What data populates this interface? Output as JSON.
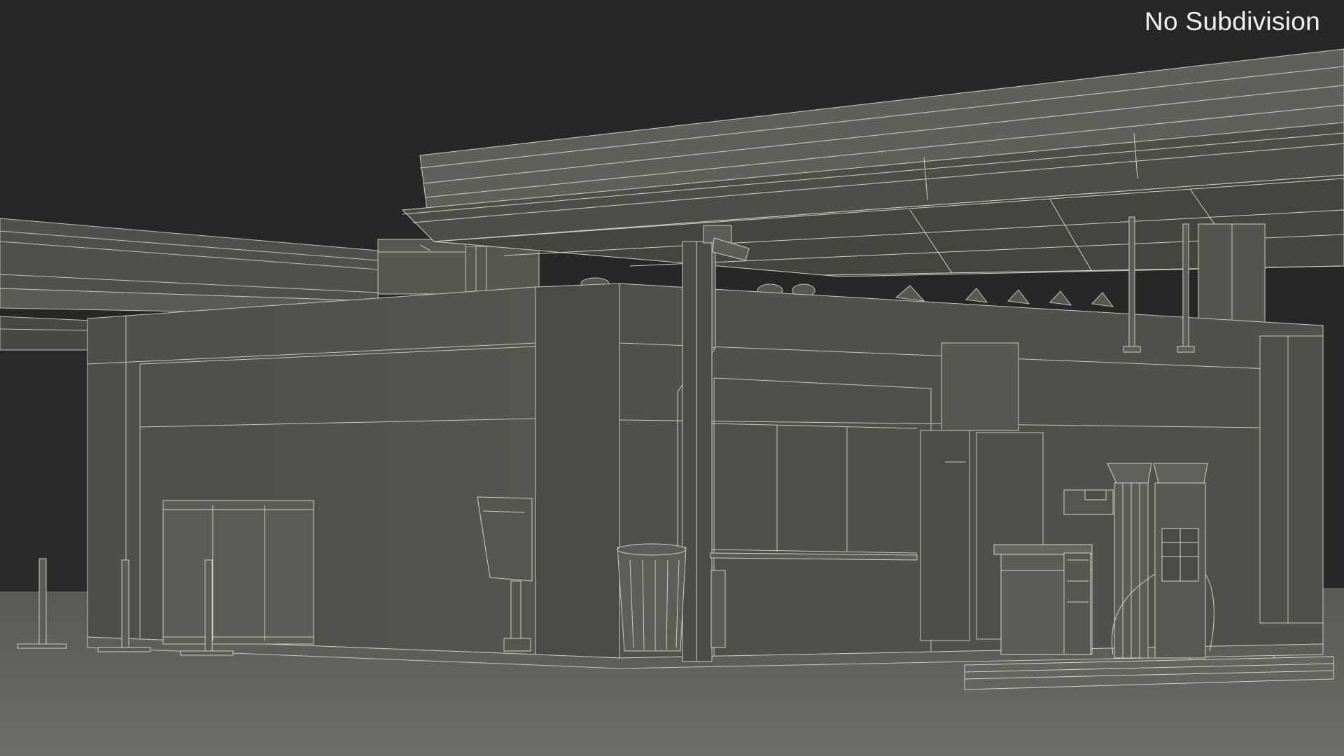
{
  "viewport": {
    "label": "No Subdivision",
    "colors": {
      "background": "#262726",
      "surface": "#5b5c56",
      "surface_dark": "#4a4b46",
      "ground": "#62645e",
      "wire": "#c9cbbf"
    }
  }
}
